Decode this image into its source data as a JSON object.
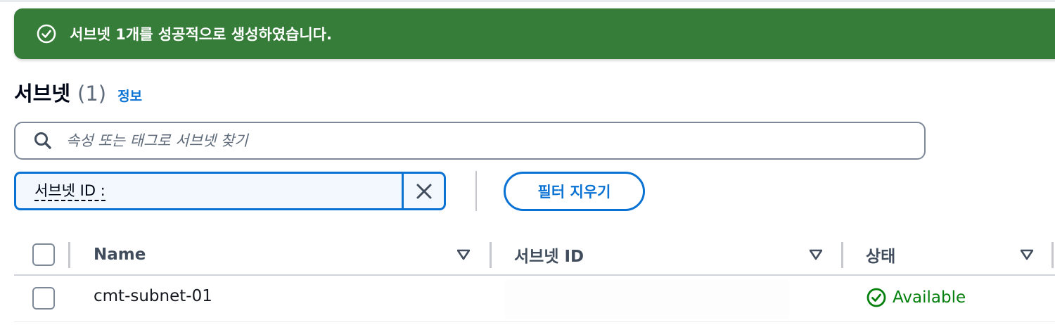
{
  "colors": {
    "flash_success": "#377d3a",
    "link_blue": "#0972d3",
    "status_green": "#037f0c"
  },
  "flash": {
    "icon": "check-circle-icon",
    "message": "서브넷 1개를 성공적으로 생성하였습니다."
  },
  "header": {
    "title": "서브넷",
    "count": "(1)",
    "info_link": "정보"
  },
  "search": {
    "icon": "search-icon",
    "placeholder": "속성 또는 태그로 서브넷 찾기",
    "value": ""
  },
  "filter_token": {
    "label": "서브넷 ID :",
    "remove_icon": "close-icon"
  },
  "clear_filters_label": "필터 지우기",
  "table": {
    "columns": [
      {
        "label": "Name",
        "sort_icon": "caret-down-icon"
      },
      {
        "label": "서브넷 ID",
        "sort_icon": "caret-down-icon"
      },
      {
        "label": "상태",
        "sort_icon": "caret-down-icon"
      }
    ],
    "rows": [
      {
        "name": "cmt-subnet-01",
        "subnet_id": "",
        "status": "Available",
        "status_icon": "check-circle-icon"
      }
    ]
  }
}
